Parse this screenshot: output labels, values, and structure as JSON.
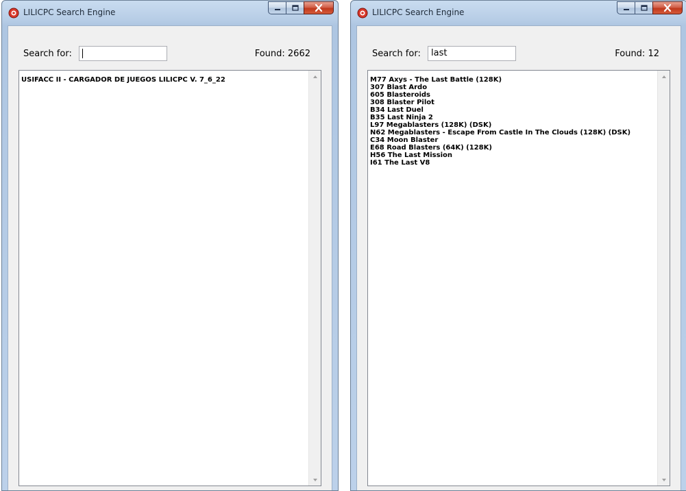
{
  "windows": [
    {
      "title": "LILICPC Search Engine",
      "search_label": "Search for:",
      "search_value": "",
      "found_text": "Found: 2662",
      "items": [
        "USIFACC II - CARGADOR DE JUEGOS LILICPC V. 7_6_22"
      ]
    },
    {
      "title": "LILICPC Search Engine",
      "search_label": "Search for:",
      "search_value": "last",
      "found_text": "Found: 12",
      "items": [
        "M77 Axys - The Last Battle (128K)",
        "307 Blast Ardo",
        "605 Blasteroids",
        "308 Blaster Pilot",
        "B34 Last Duel",
        "B35 Last Ninja 2",
        "L97 Megablasters (128K) (DSK)",
        "N62 Megablasters - Escape From Castle In The Clouds (128K) (DSK)",
        "C34 Moon Blaster",
        "E68 Road Blasters (64K) (128K)",
        "H56 The Last Mission",
        "I61 The Last V8"
      ]
    }
  ],
  "icons": {
    "app": "app-logo-icon",
    "minimize": "minimize-icon",
    "maximize": "maximize-icon",
    "close": "close-icon",
    "scroll_up": "scroll-up-arrow-icon",
    "scroll_down": "scroll-down-arrow-icon"
  },
  "colors": {
    "close_button": "#c0391d",
    "title_bar": "#b7cde6",
    "client_bg": "#f0f0f0"
  }
}
